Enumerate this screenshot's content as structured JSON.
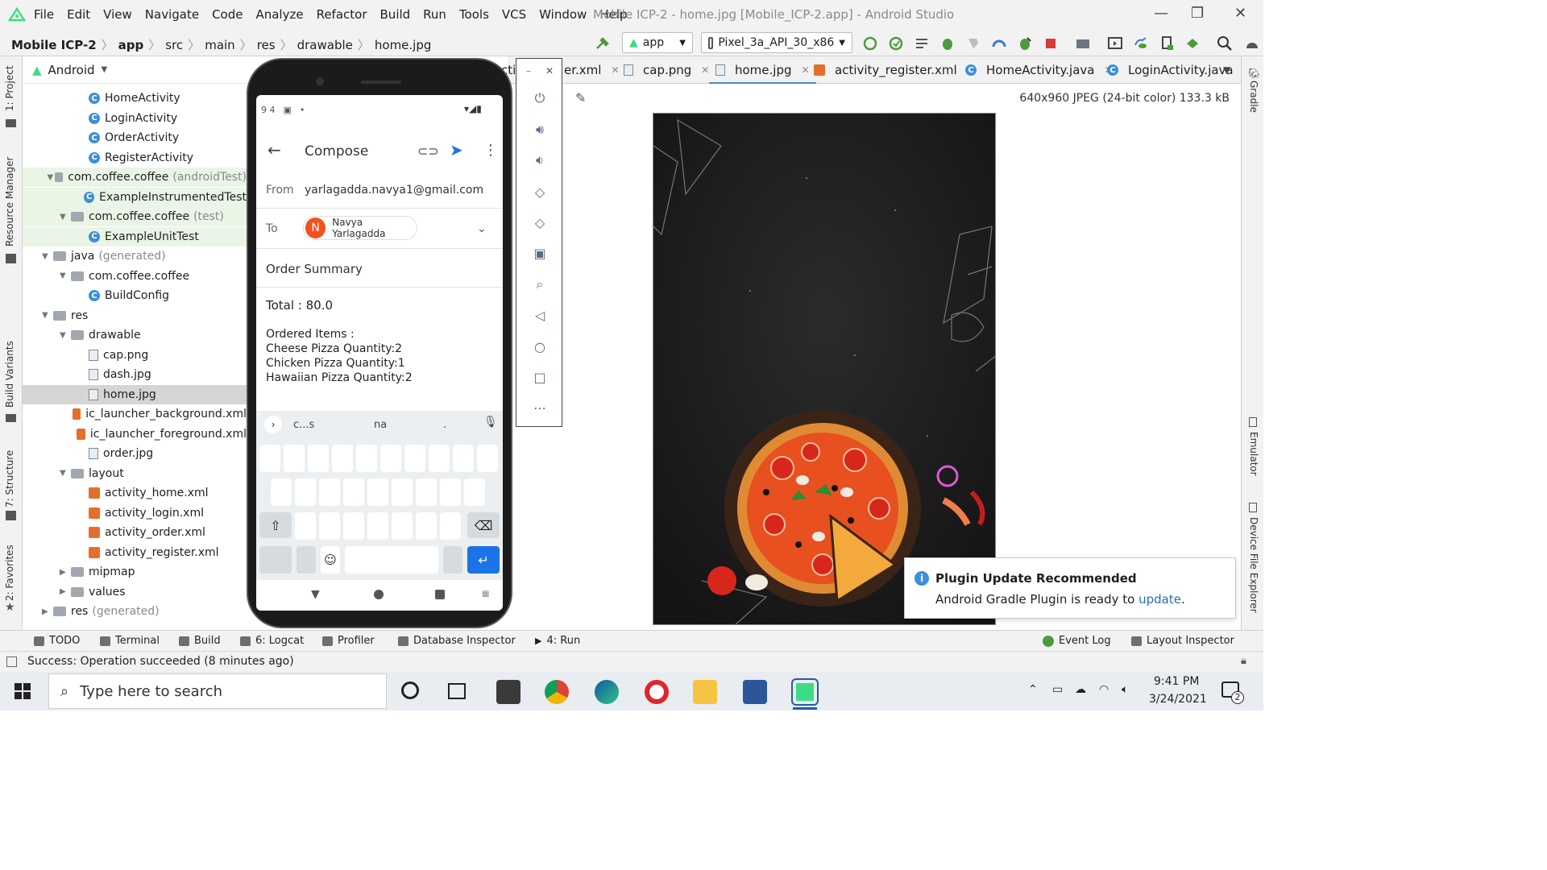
{
  "menu": [
    "File",
    "Edit",
    "View",
    "Navigate",
    "Code",
    "Analyze",
    "Refactor",
    "Build",
    "Run",
    "Tools",
    "VCS",
    "Window",
    "Help"
  ],
  "window_title": "Mobile ICP-2 - home.jpg [Mobile_ICP-2.app] - Android Studio",
  "breadcrumb": [
    "Mobile ICP-2",
    "app",
    "src",
    "main",
    "res",
    "drawable",
    "home.jpg"
  ],
  "toolbar": {
    "config": "app",
    "device": "Pixel_3a_API_30_x86"
  },
  "project_view": "Android",
  "tree": [
    {
      "label": "HomeActivity",
      "icon": "class",
      "indent": 4
    },
    {
      "label": "LoginActivity",
      "icon": "class",
      "indent": 4
    },
    {
      "label": "OrderActivity",
      "icon": "class",
      "indent": 4
    },
    {
      "label": "RegisterActivity",
      "icon": "class",
      "indent": 4
    },
    {
      "label": "com.coffee.coffee",
      "suffix": "(androidTest)",
      "icon": "folder",
      "indent": 3,
      "green": true,
      "arrow": true
    },
    {
      "label": "ExampleInstrumentedTest",
      "icon": "class",
      "indent": 4,
      "green": true
    },
    {
      "label": "com.coffee.coffee",
      "suffix": "(test)",
      "icon": "folder",
      "indent": 3,
      "green": true,
      "arrow": true
    },
    {
      "label": "ExampleUnitTest",
      "icon": "class",
      "indent": 4,
      "green": true
    },
    {
      "label": "java",
      "suffix": "(generated)",
      "icon": "folder",
      "indent": 2,
      "arrow": true
    },
    {
      "label": "com.coffee.coffee",
      "icon": "folder",
      "indent": 3,
      "arrow": true
    },
    {
      "label": "BuildConfig",
      "icon": "class",
      "indent": 4
    },
    {
      "label": "res",
      "icon": "folder",
      "indent": 2,
      "arrow": true
    },
    {
      "label": "drawable",
      "icon": "folder",
      "indent": 3,
      "arrow": true
    },
    {
      "label": "cap.png",
      "icon": "file",
      "indent": 4
    },
    {
      "label": "dash.jpg",
      "icon": "file",
      "indent": 4
    },
    {
      "label": "home.jpg",
      "icon": "file",
      "indent": 4,
      "selected": true
    },
    {
      "label": "ic_launcher_background.xml",
      "icon": "xml",
      "indent": 4
    },
    {
      "label": "ic_launcher_foreground.xml",
      "icon": "xml",
      "indent": 4
    },
    {
      "label": "order.jpg",
      "icon": "file",
      "indent": 4
    },
    {
      "label": "layout",
      "icon": "folder",
      "indent": 3,
      "arrow": true
    },
    {
      "label": "activity_home.xml",
      "icon": "xml",
      "indent": 4
    },
    {
      "label": "activity_login.xml",
      "icon": "xml",
      "indent": 4
    },
    {
      "label": "activity_order.xml",
      "icon": "xml",
      "indent": 4
    },
    {
      "label": "activity_register.xml",
      "icon": "xml",
      "indent": 4
    },
    {
      "label": "mipmap",
      "icon": "folder",
      "indent": 3,
      "arrow": true,
      "collapsed": true
    },
    {
      "label": "values",
      "icon": "folder",
      "indent": 3,
      "arrow": true,
      "collapsed": true
    },
    {
      "label": "res",
      "suffix": "(generated)",
      "icon": "folder",
      "indent": 2,
      "arrow": true,
      "collapsed": true
    }
  ],
  "editor_tabs": [
    {
      "label": "cti",
      "icon": "xml"
    },
    {
      "label": "er.xml",
      "icon": "xml"
    },
    {
      "label": "cap.png",
      "icon": "file"
    },
    {
      "label": "home.jpg",
      "icon": "file",
      "active": true
    },
    {
      "label": "activity_register.xml",
      "icon": "xml"
    },
    {
      "label": "HomeActivity.java",
      "icon": "class"
    },
    {
      "label": "LoginActivity.java",
      "icon": "class"
    }
  ],
  "image_info": "640x960 JPEG (24-bit color) 133.3 kB",
  "left_tabs": [
    "1: Project",
    "Resource Manager",
    "Build Variants",
    "7: Structure",
    "2: Favorites"
  ],
  "right_tabs": [
    "Gradle",
    "Emulator",
    "Device File Explorer"
  ],
  "phone": {
    "status_time": "9 4",
    "app_title": "Compose",
    "from_label": "From",
    "from_value": "yarlagadda.navya1@gmail.com",
    "to_label": "To",
    "to_avatar": "N",
    "to_value": "Navya Yarlagadda",
    "subject": "Order Summary",
    "body": [
      "Total : 80.0",
      "",
      "Ordered Items :",
      "Cheese Pizza Quantity:2",
      "Chicken Pizza Quantity:1",
      "Hawaiian Pizza Quantity:2"
    ],
    "suggestions": [
      "c...s",
      "na",
      "."
    ]
  },
  "notification": {
    "title": "Plugin Update Recommended",
    "body": "Android Gradle Plugin is ready to ",
    "link": "update",
    "suffix": "."
  },
  "bottom_tools": [
    {
      "label": "TODO"
    },
    {
      "label": "Terminal"
    },
    {
      "label": "Build"
    },
    {
      "label": "6: Logcat"
    },
    {
      "label": "Profiler"
    },
    {
      "label": "Database Inspector"
    },
    {
      "label": "4: Run"
    }
  ],
  "bottom_right_tools": [
    {
      "label": "Event Log"
    },
    {
      "label": "Layout Inspector"
    }
  ],
  "status": "Success: Operation succeeded (8 minutes ago)",
  "taskbar": {
    "search_placeholder": "Type here to search",
    "time": "9:41 PM",
    "date": "3/24/2021",
    "notif_count": "2"
  }
}
